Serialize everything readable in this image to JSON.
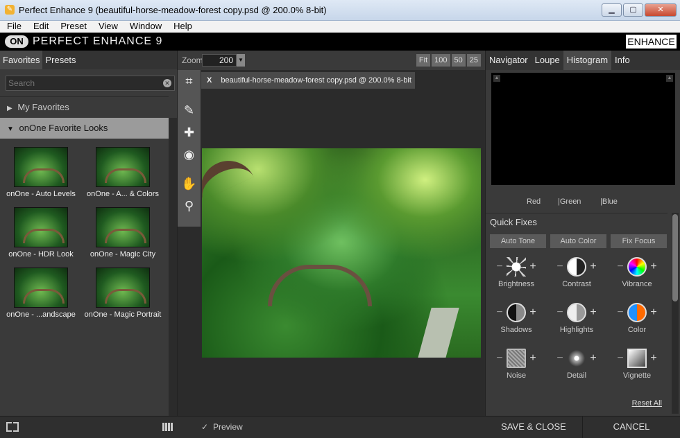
{
  "window": {
    "title": "Perfect Enhance 9 (beautiful-horse-meadow-forest copy.psd @ 200.0% 8-bit)",
    "controls": [
      "▁",
      "▢",
      "✕"
    ]
  },
  "menu": [
    "File",
    "Edit",
    "Preset",
    "View",
    "Window",
    "Help"
  ],
  "header": {
    "logo_mark": "ON",
    "app_name": "PERFECT ENHANCE 9",
    "mode_button": "ENHANCE"
  },
  "left_panel": {
    "tabs": [
      "Favorites",
      "Presets"
    ],
    "search_placeholder": "Search",
    "groups": {
      "my_favorites": "My Favorites",
      "favorite_looks": "onOne Favorite Looks"
    },
    "presets": [
      "onOne - Auto Levels",
      "onOne - A... & Colors",
      "onOne - HDR Look",
      "onOne - Magic City",
      "onOne - ...andscape",
      "onOne - Magic Portrait"
    ]
  },
  "canvas": {
    "zoom_label": "Zoom",
    "zoom_value": "200",
    "zoom_presets": [
      "Fit",
      "100",
      "50",
      "25"
    ],
    "doc_tab_close": "X",
    "doc_tab": "beautiful-horse-meadow-forest copy.psd @ 200.0% 8-bit",
    "preview_label": "Preview"
  },
  "right_panel": {
    "tabs": [
      "Navigator",
      "Loupe",
      "Histogram",
      "Info"
    ],
    "channels": [
      "Red",
      "|Green",
      "|Blue"
    ],
    "quick_fixes": {
      "title": "Quick Fixes",
      "buttons": [
        "Auto Tone",
        "Auto Color",
        "Fix Focus"
      ],
      "items": [
        "Brightness",
        "Contrast",
        "Vibrance",
        "Shadows",
        "Highlights",
        "Color",
        "Noise",
        "Detail",
        "Vignette"
      ],
      "reset": "Reset All"
    }
  },
  "footer": {
    "save_close": "SAVE & CLOSE",
    "cancel": "CANCEL"
  }
}
